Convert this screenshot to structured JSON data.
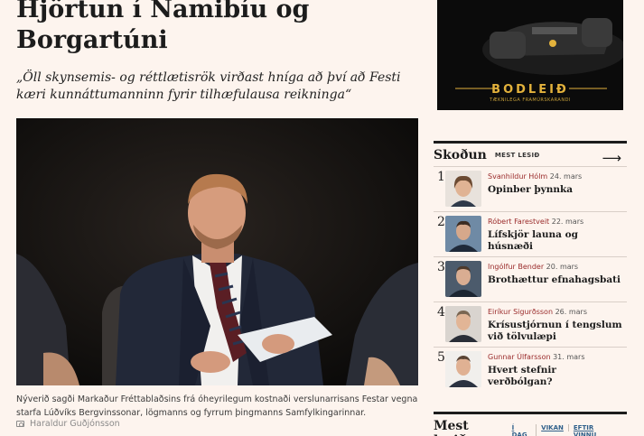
{
  "article": {
    "title": "Hjörtun í Namibíu og Borgartúni",
    "lead": "„Öll skynsemis- og réttlætisrök virðast hníga að því að Festi kæri kunnáttumanninn fyrir tilhæfulausa reikninga“",
    "caption": "Nýverið sagði Markaður Fréttablaðsins frá óheyrilegum kostnaði verslunarrisans Festar vegna starfa Lúðvíks Bergvinssonar, lögmanns og fyrrum þingmanns Samfylkingarinnar.",
    "photo_credit": "Haraldur Guðjónsson",
    "credit_icon": "camera-icon"
  },
  "ad": {
    "brand": "BODLEIÐ",
    "tagline": "TÆKNILEGA FRAMÚRSKARANDI"
  },
  "skodun": {
    "title": "Skoðun",
    "subtitle": "MEST LESIÐ",
    "arrow_icon": "arrow-right-icon",
    "items": [
      {
        "rank": "1",
        "author": "Svanhildur Hólm",
        "date": "24. mars",
        "headline": "Opinber þynnka"
      },
      {
        "rank": "2",
        "author": "Róbert Farestveit",
        "date": "22. mars",
        "headline": "Lífskjör launa og húsnæði"
      },
      {
        "rank": "3",
        "author": "Ingólfur Bender",
        "date": "20. mars",
        "headline": "Brothættur efnahagsbati"
      },
      {
        "rank": "4",
        "author": "Eiríkur Sigurðsson",
        "date": "26. mars",
        "headline": "Krísustjórnun í tengslum við tölvulæpi"
      },
      {
        "rank": "5",
        "author": "Gunnar Úlfarsson",
        "date": "31. mars",
        "headline": "Hvert stefnir verðbólgan?"
      }
    ]
  },
  "mest_lesid": {
    "title": "Mest lesið",
    "tabs": [
      "Í DAG",
      "VIKAN",
      "EFTIR VINNU"
    ]
  },
  "colors": {
    "background": "#fdf4ee",
    "author_red": "#9a2b2b",
    "tab_blue": "#2e5f8a",
    "ad_gold": "#e3b23c"
  }
}
